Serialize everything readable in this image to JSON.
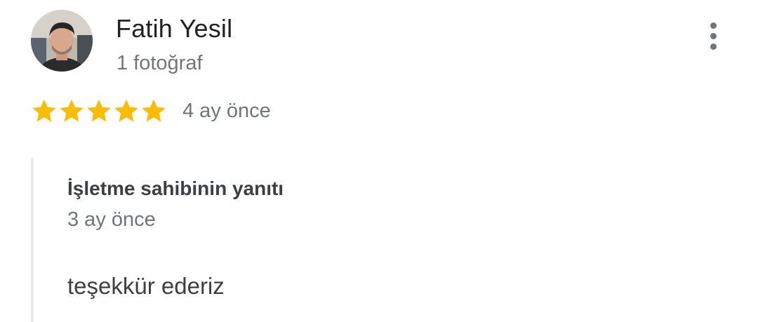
{
  "review": {
    "author_name": "Fatih Yesil",
    "author_meta": "1 fotoğraf",
    "rating": 5,
    "rating_max": 5,
    "date": "4 ay önce",
    "star_color": "#FBBC04",
    "avatar_icon": "user-avatar-photo",
    "menu_icon": "more-vert-icon"
  },
  "owner_reply": {
    "title": "İşletme sahibinin yanıtı",
    "date": "3 ay önce",
    "text": "teşekkür ederiz"
  }
}
